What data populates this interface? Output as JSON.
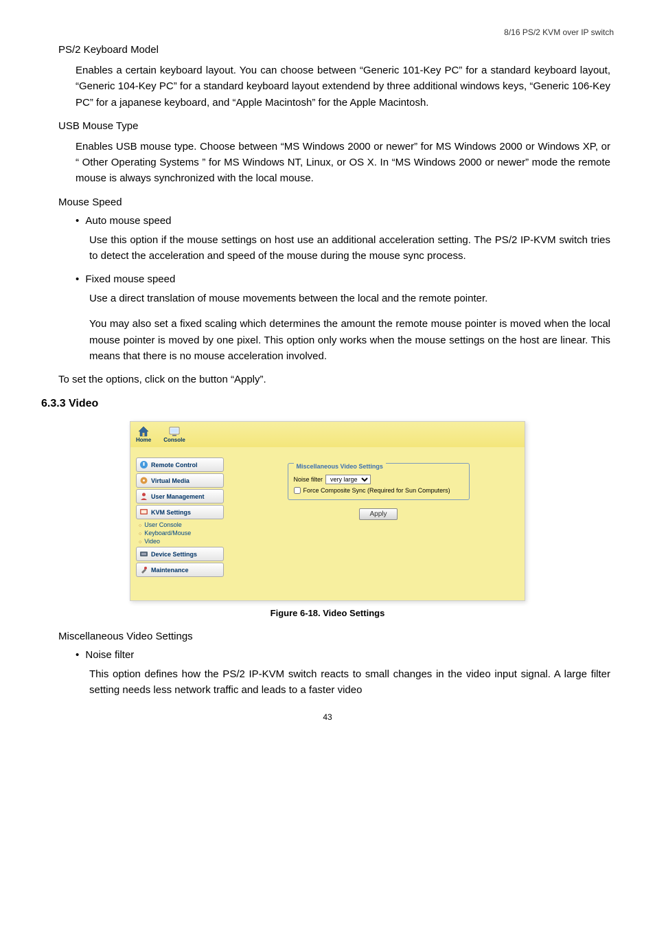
{
  "header": "8/16 PS/2 KVM over IP switch",
  "s1": {
    "title": "PS/2 Keyboard Model",
    "para": "Enables a certain keyboard layout. You can choose between “Generic 101-Key PC” for a standard keyboard layout, “Generic 104-Key PC” for a standard keyboard layout extendend by three additional windows keys, “Generic 106-Key PC” for a japanese keyboard, and “Apple Macintosh” for the Apple Macintosh."
  },
  "s2": {
    "title": "USB Mouse Type",
    "para": "Enables USB mouse type. Choose between “MS Windows 2000 or newer” for MS Windows 2000 or Windows XP, or “ Other Operating Systems ” for MS Windows NT, Linux, or OS X. In “MS Windows 2000 or newer” mode the remote mouse is always synchronized with the local mouse."
  },
  "s3": {
    "title": "Mouse Speed",
    "b1": "Auto mouse speed",
    "b1p": "Use this option if the mouse settings on host use an additional acceleration setting. The PS/2 IP-KVM switch tries to detect the acceleration and speed of the mouse during the mouse sync process.",
    "b2": "Fixed mouse speed",
    "b2p1": "Use a direct translation of mouse movements between the local and the remote pointer.",
    "b2p2": "You may also set a fixed scaling which determines the amount the remote mouse pointer is moved when the local mouse pointer is moved by one pixel. This option only works when the mouse settings on the host are linear. This means that there is no mouse acceleration involved."
  },
  "apply_note": "To set the options, click on the button “Apply”.",
  "heading": "6.3.3   Video",
  "figure": {
    "home": "Home",
    "console": "Console",
    "sidebar": {
      "remote_control": "Remote Control",
      "virtual_media": "Virtual Media",
      "user_mgmt": "User Management",
      "kvm_settings": "KVM Settings",
      "sub": {
        "user_console": "User Console",
        "keyboard_mouse": "Keyboard/Mouse",
        "video": "Video"
      },
      "device_settings": "Device Settings",
      "maintenance": "Maintenance"
    },
    "panel": {
      "legend": "Miscellaneous Video Settings",
      "noise_label": "Noise filter",
      "noise_value": "very large",
      "sync_label": "Force Composite Sync (Required for Sun Computers)",
      "apply": "Apply"
    },
    "caption": "Figure 6-18. Video Settings"
  },
  "s4": {
    "title": "Miscellaneous Video Settings",
    "b1": "Noise filter",
    "b1p": "This option defines how the PS/2 IP-KVM switch reacts to small changes in the video input signal. A large filter setting needs less network traffic and leads to a faster video"
  },
  "page_number": "43"
}
